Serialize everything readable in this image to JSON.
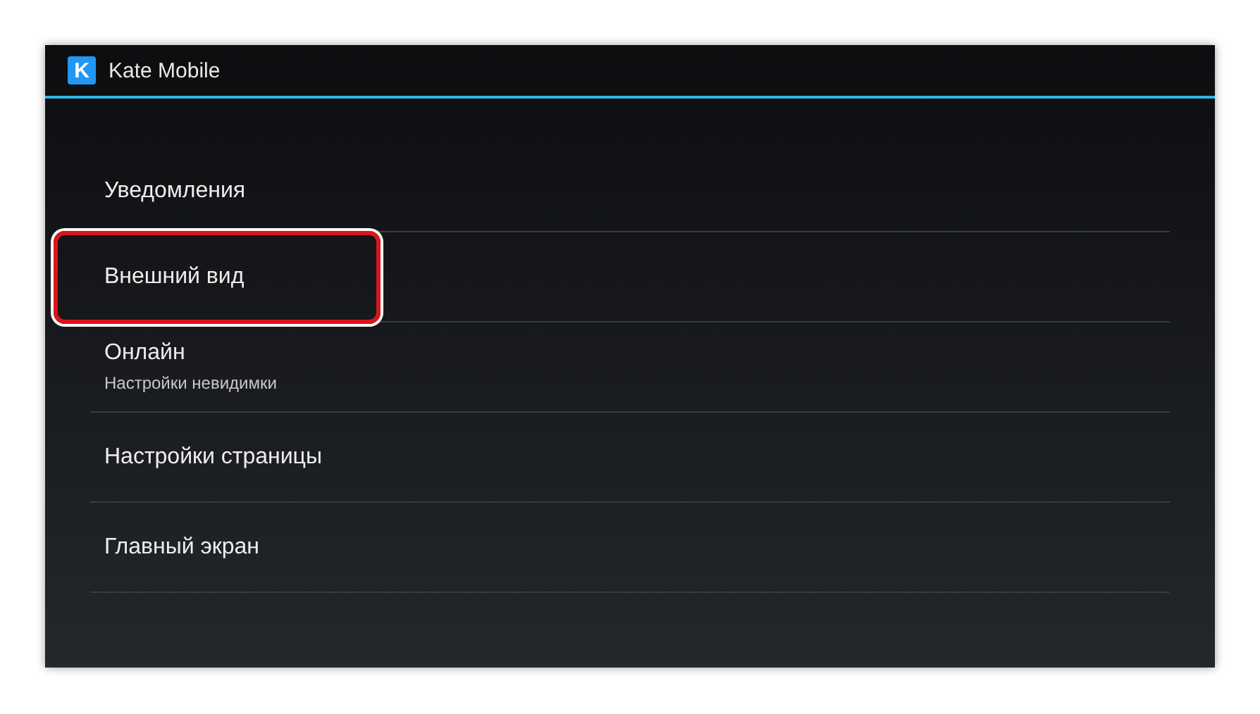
{
  "app_bar": {
    "title": "Kate Mobile",
    "logo_letter": "K"
  },
  "settings": [
    {
      "title": "Уведомления",
      "highlighted": false
    },
    {
      "title": "Внешний вид",
      "highlighted": true
    },
    {
      "title": "Онлайн",
      "subtitle": "Настройки невидимки",
      "highlighted": false
    },
    {
      "title": "Настройки страницы",
      "highlighted": false
    },
    {
      "title": "Главный экран",
      "highlighted": false
    }
  ]
}
